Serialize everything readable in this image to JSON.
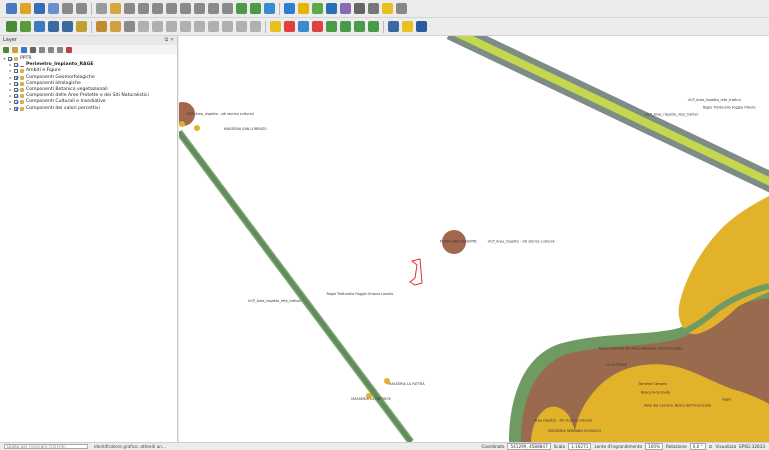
{
  "toolbar": {
    "row1": [
      {
        "name": "new-project-icon",
        "color": "#4a78c2"
      },
      {
        "name": "open-project-icon",
        "color": "#e0a32a"
      },
      {
        "name": "save-project-icon",
        "color": "#3b6bb5"
      },
      {
        "name": "save-as-icon",
        "color": "#6a8fd0"
      },
      {
        "name": "print-layout-icon",
        "color": "#8a8a8a"
      },
      {
        "name": "layout-manager-icon",
        "color": "#8a8a8a"
      },
      {
        "sep": true
      },
      {
        "name": "pan-icon",
        "color": "#9a9a9a"
      },
      {
        "name": "pan-to-selection-icon",
        "color": "#d4a83a"
      },
      {
        "name": "zoom-in-icon",
        "color": "#8a8a8a"
      },
      {
        "name": "zoom-out-icon",
        "color": "#8a8a8a"
      },
      {
        "name": "zoom-native-icon",
        "color": "#8a8a8a"
      },
      {
        "name": "zoom-full-icon",
        "color": "#8a8a8a"
      },
      {
        "name": "zoom-to-layer-icon",
        "color": "#8a8a8a"
      },
      {
        "name": "zoom-to-selection-icon",
        "color": "#8a8a8a"
      },
      {
        "name": "zoom-last-icon",
        "color": "#8a8a8a"
      },
      {
        "name": "zoom-next-icon",
        "color": "#8a8a8a"
      },
      {
        "name": "new-map-view-icon",
        "color": "#4a9a4a"
      },
      {
        "name": "temporal-controller-icon",
        "color": "#4a9a4a"
      },
      {
        "name": "refresh-icon",
        "color": "#3a8ad0"
      },
      {
        "sep": true
      },
      {
        "name": "identify-icon",
        "color": "#2a7fd0"
      },
      {
        "name": "select-features-icon",
        "color": "#e3b400"
      },
      {
        "name": "deselect-icon",
        "color": "#5aaa4a"
      },
      {
        "name": "open-attribute-table-icon",
        "color": "#2a6fb5"
      },
      {
        "name": "field-calculator-icon",
        "color": "#8a6ab5"
      },
      {
        "name": "statistics-icon",
        "color": "#666666"
      },
      {
        "name": "measure-icon",
        "color": "#777777"
      },
      {
        "name": "annotation-icon",
        "color": "#e8c020"
      },
      {
        "name": "search-icon",
        "color": "#888888"
      }
    ],
    "row2": [
      {
        "name": "data-source-manager-icon",
        "color": "#4a8a3a"
      },
      {
        "name": "add-vector-layer-icon",
        "color": "#5a9a3a"
      },
      {
        "name": "add-raster-layer-icon",
        "color": "#3a7ac0"
      },
      {
        "name": "add-postgis-layer-icon",
        "color": "#3a6aa0"
      },
      {
        "name": "add-wms-layer-icon",
        "color": "#3a6aa0"
      },
      {
        "name": "new-shapefile-icon",
        "color": "#c0a030"
      },
      {
        "sep": true
      },
      {
        "name": "current-edits-icon",
        "color": "#c08a30"
      },
      {
        "name": "toggle-editing-icon",
        "color": "#d0a040"
      },
      {
        "name": "save-edits-icon",
        "color": "#8a8a8a"
      },
      {
        "name": "digitize-icon",
        "color": "#b0b0b0"
      },
      {
        "name": "add-feature-icon",
        "color": "#b0b0b0"
      },
      {
        "name": "vertex-tool-icon",
        "color": "#b0b0b0"
      },
      {
        "name": "delete-selected-icon",
        "color": "#b0b0b0"
      },
      {
        "name": "cut-features-icon",
        "color": "#b0b0b0"
      },
      {
        "name": "copy-features-icon",
        "color": "#b0b0b0"
      },
      {
        "name": "paste-features-icon",
        "color": "#b0b0b0"
      },
      {
        "name": "undo-icon",
        "color": "#b0b0b0"
      },
      {
        "name": "redo-icon",
        "color": "#b0b0b0"
      },
      {
        "sep": true
      },
      {
        "name": "label-toolbar-icon",
        "color": "#e8c020"
      },
      {
        "name": "label-pin-icon",
        "color": "#e04040"
      },
      {
        "name": "label-show-hide-icon",
        "color": "#3a8ad0"
      },
      {
        "name": "label-move-icon",
        "color": "#e04040"
      },
      {
        "name": "label-rotate-icon",
        "color": "#4a9a4a"
      },
      {
        "name": "label-change-icon",
        "color": "#4a9a4a"
      },
      {
        "name": "diagram-pin-icon",
        "color": "#4a9a4a"
      },
      {
        "name": "diagram-move-icon",
        "color": "#4a9a4a"
      },
      {
        "sep": true
      },
      {
        "name": "plugin-icon",
        "color": "#3a6aa0"
      },
      {
        "name": "python-console-icon",
        "color": "#e8c020"
      },
      {
        "name": "processing-toolbox-icon",
        "color": "#2a5aa0"
      }
    ]
  },
  "layers_panel": {
    "title": "Layer",
    "tools": [
      {
        "name": "open-layer-styling-icon",
        "color": "#4a8a3a"
      },
      {
        "name": "add-group-icon",
        "color": "#d0a040"
      },
      {
        "name": "manage-visibility-icon",
        "color": "#3a7ac0"
      },
      {
        "name": "filter-legend-icon",
        "color": "#666666"
      },
      {
        "name": "filter-by-expression-icon",
        "color": "#888888"
      },
      {
        "name": "expand-all-icon",
        "color": "#888888"
      },
      {
        "name": "collapse-all-icon",
        "color": "#888888"
      },
      {
        "name": "remove-layer-icon",
        "color": "#c04040"
      }
    ],
    "items": [
      {
        "label": "PPTR",
        "depth": 0,
        "checked": true,
        "expanded": true,
        "bold": false,
        "kind": "group"
      },
      {
        "label": "Perimetro_Impianto_RAGE",
        "depth": 1,
        "checked": true,
        "expanded": false,
        "bold": true,
        "kind": "line"
      },
      {
        "label": "Ambiti e Figure",
        "depth": 1,
        "checked": false,
        "expanded": false,
        "bold": false,
        "kind": "group"
      },
      {
        "label": "Componenti Geomorfologiche",
        "depth": 1,
        "checked": true,
        "expanded": false,
        "bold": false,
        "kind": "group"
      },
      {
        "label": "Componenti Idrologiche",
        "depth": 1,
        "checked": true,
        "expanded": false,
        "bold": false,
        "kind": "group"
      },
      {
        "label": "Componenti Botanico vegetazionali",
        "depth": 1,
        "checked": true,
        "expanded": false,
        "bold": false,
        "kind": "group"
      },
      {
        "label": "Componenti delle Aree Protette e dei Siti Naturalistici",
        "depth": 1,
        "checked": true,
        "expanded": false,
        "bold": false,
        "kind": "group"
      },
      {
        "label": "Componenti Culturali e Insediative",
        "depth": 1,
        "checked": true,
        "expanded": false,
        "bold": false,
        "kind": "group"
      },
      {
        "label": "Componenti dei valori percettivi",
        "depth": 1,
        "checked": true,
        "expanded": false,
        "bold": false,
        "kind": "group"
      }
    ]
  },
  "map": {
    "colors": {
      "road_casing": "#7e8c86",
      "road_fill": "#c3d84e",
      "tratturo_fill": "#5f8c58",
      "tratturo_casing": "#7ea474",
      "buffer_green": "#6f9a62",
      "area_brown": "#9a6a4e",
      "area_yellow": "#e2b22a",
      "point_brown": "#a0684c",
      "site_outline": "#e03030"
    },
    "labels": [
      {
        "text": "UCP_Area_rispetto_rete_tratturi",
        "fx": 0.862,
        "fy": 0.16
      },
      {
        "text": "Regio Tratturello Foggia Ofanto",
        "fx": 0.888,
        "fy": 0.178
      },
      {
        "text": "UCP_Area_rispetto_rete_tratturi",
        "fx": 0.79,
        "fy": 0.196
      },
      {
        "text": "UCP_Area_rispetto - siti storico culturali",
        "fx": 0.013,
        "fy": 0.194
      },
      {
        "text": "MASSERIA SAN LORENZO",
        "fx": 0.076,
        "fy": 0.232
      },
      {
        "text": "POSTA SAN GIUSEPPE",
        "fx": 0.442,
        "fy": 0.509
      },
      {
        "text": "UCP_Area_rispetto - siti storico culturali",
        "fx": 0.523,
        "fy": 0.509
      },
      {
        "text": "Regio Tratturello Foggia Ordona Lavello",
        "fx": 0.25,
        "fy": 0.638
      },
      {
        "text": "UCP_Area_rispetto_rete_tratturi",
        "fx": 0.117,
        "fy": 0.655
      },
      {
        "text": "Bosco Agricolo del Parco Naturale dell'Incoronata",
        "fx": 0.712,
        "fy": 0.772
      },
      {
        "text": "LA FATTRICE",
        "fx": 0.724,
        "fy": 0.813
      },
      {
        "text": "MASSERIA LA FATTRA",
        "fx": 0.355,
        "fy": 0.86
      },
      {
        "text": "MASSERIA LA FATTRICE",
        "fx": 0.292,
        "fy": 0.897
      },
      {
        "text": "Torrente Cervaro",
        "fx": 0.779,
        "fy": 0.859
      },
      {
        "text": "Bosco Incoronata",
        "fx": 0.783,
        "fy": 0.88
      },
      {
        "text": "Valle del Cervaro, Bosco dell'Incoronata",
        "fx": 0.788,
        "fy": 0.912
      },
      {
        "text": "Fagni",
        "fx": 0.921,
        "fy": 0.898
      },
      {
        "text": "Area rispetto - siti storico culturali",
        "fx": 0.602,
        "fy": 0.95
      },
      {
        "text": "MASSERIA SERRANO DI MIGLIO",
        "fx": 0.626,
        "fy": 0.975
      }
    ]
  },
  "status_bar": {
    "search_placeholder": "Digita per ricercare (Ctrl+K)",
    "message": "Identificatore grafico: attendi un...",
    "coord_label": "Coordinate",
    "coord_value": "541299, 4588847",
    "scale_label": "Scala",
    "scale_value": "1:16271",
    "magnifier_label": "Lente d'ingrandimento",
    "magnifier_value": "100%",
    "rotation_label": "Rotazione",
    "rotation_value": "0,0 °",
    "render_label": "Visualizza",
    "crs_label": "EPSG:32633"
  }
}
